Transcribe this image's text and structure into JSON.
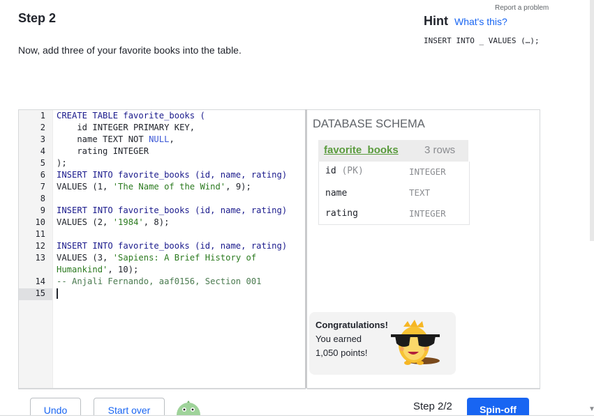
{
  "header": {
    "step_title": "Step 2",
    "prompt": "Now, add three of your favorite books into the table.",
    "report_link": "Report a problem",
    "hint_title": "Hint",
    "hint_link": "What's this?",
    "hint_code": "INSERT INTO _ VALUES (…);"
  },
  "editor": {
    "line_numbers": [
      "1",
      "2",
      "3",
      "4",
      "5",
      "6",
      "7",
      "8",
      "9",
      "10",
      "11",
      "12",
      "13",
      "14",
      "15"
    ],
    "lines": {
      "l1": "CREATE TABLE favorite_books (",
      "l2": "    id INTEGER PRIMARY KEY,",
      "l3a": "    name TEXT NOT ",
      "l3b": "NULL",
      "l3c": ",",
      "l4": "    rating INTEGER",
      "l5": ");",
      "l6": "INSERT INTO favorite_books (id, name, rating)",
      "l7a": "VALUES (1, ",
      "l7b": "'The Name of the Wind'",
      "l7c": ", 9);",
      "l9": "INSERT INTO favorite_books (id, name, rating)",
      "l10a": "VALUES (2, ",
      "l10b": "'1984'",
      "l10c": ", 8);",
      "l12": "INSERT INTO favorite_books (id, name, rating)",
      "l13a": "VALUES (3, ",
      "l13b": "'Sapiens: A Brief History of",
      "l13c": "Humankind'",
      "l13d": ", 10);",
      "l14": "-- Anjali Fernando, aaf0156, Section 001"
    }
  },
  "schema": {
    "title": "DATABASE SCHEMA",
    "table_name": "favorite_books",
    "row_count": "3 rows",
    "columns": [
      {
        "name": "id",
        "pk": "(PK)",
        "type": "INTEGER"
      },
      {
        "name": "name",
        "pk": "",
        "type": "TEXT"
      },
      {
        "name": "rating",
        "pk": "",
        "type": "INTEGER"
      }
    ]
  },
  "congrats": {
    "title": "Congratulations!",
    "line1": "You earned",
    "line2": "1,050 points!"
  },
  "footer": {
    "undo": "Undo",
    "start_over": "Start over",
    "step_count": "Step 2/2",
    "spinoff": "Spin-off"
  },
  "colors": {
    "accent": "#1865f2",
    "schema_table": "#5a9b3d",
    "string": "#2b7a1f",
    "keyword_null": "#3b57d6"
  }
}
